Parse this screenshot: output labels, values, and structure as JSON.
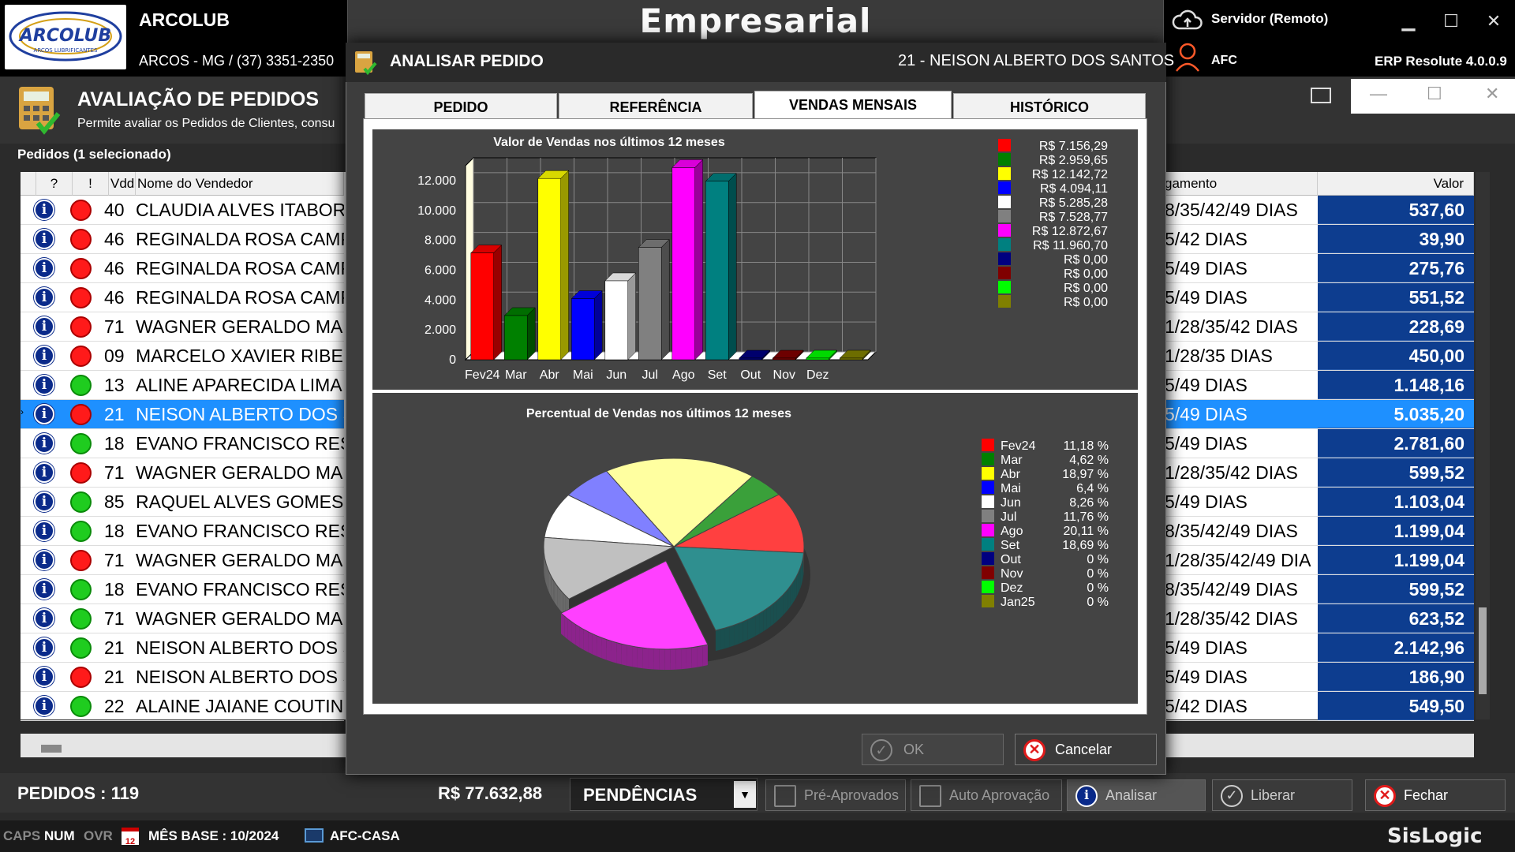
{
  "header": {
    "logo_text": "ARCOLUB",
    "logo_sub": "ARCOS LUBRIFICANTES",
    "company": "ARCOLUB",
    "address": "ARCOS - MG / (37) 3351-2350",
    "app_title": "Empresarial",
    "server": "Servidor (Remoto)",
    "user": "AFC",
    "erp": "ERP Resolute 4.0.0.9"
  },
  "screen": {
    "title": "AVALIAÇÃO DE PEDIDOS",
    "description": "Permite avaliar os Pedidos de Clientes, consu",
    "selection_label": "Pedidos (1 selecionado)"
  },
  "grid": {
    "headers": {
      "q": "?",
      "excl": "!",
      "vdd": "Vdd",
      "name": "Nome do Vendedor",
      "pay": "gamento",
      "value": "Valor"
    },
    "rows": [
      {
        "status": "red",
        "vdd": "40",
        "name": "CLAUDIA ALVES ITABORA",
        "pay": "8/35/42/49 DIAS",
        "value": "537,60",
        "selected": false
      },
      {
        "status": "red",
        "vdd": "46",
        "name": "REGINALDA ROSA CAMP",
        "pay": "5/42 DIAS",
        "value": "39,90",
        "selected": false
      },
      {
        "status": "red",
        "vdd": "46",
        "name": "REGINALDA ROSA CAMP",
        "pay": "5/49 DIAS",
        "value": "275,76",
        "selected": false
      },
      {
        "status": "red",
        "vdd": "46",
        "name": "REGINALDA ROSA CAMP",
        "pay": "5/49 DIAS",
        "value": "551,52",
        "selected": false
      },
      {
        "status": "red",
        "vdd": "71",
        "name": "WAGNER GERALDO MAR",
        "pay": "1/28/35/42 DIAS",
        "value": "228,69",
        "selected": false
      },
      {
        "status": "red",
        "vdd": "09",
        "name": "MARCELO XAVIER RIBEIR",
        "pay": "1/28/35 DIAS",
        "value": "450,00",
        "selected": false
      },
      {
        "status": "green",
        "vdd": "13",
        "name": "ALINE APARECIDA LIMA",
        "pay": "5/49 DIAS",
        "value": "1.148,16",
        "selected": false
      },
      {
        "status": "red",
        "vdd": "21",
        "name": "NEISON ALBERTO DOS S",
        "pay": "5/49 DIAS",
        "value": "5.035,20",
        "selected": true
      },
      {
        "status": "green",
        "vdd": "18",
        "name": "EVANO FRANCISCO RESE",
        "pay": "5/49 DIAS",
        "value": "2.781,60",
        "selected": false
      },
      {
        "status": "red",
        "vdd": "71",
        "name": "WAGNER GERALDO MAR",
        "pay": "1/28/35/42 DIAS",
        "value": "599,52",
        "selected": false
      },
      {
        "status": "green",
        "vdd": "85",
        "name": "RAQUEL ALVES GOMES",
        "pay": "5/49 DIAS",
        "value": "1.103,04",
        "selected": false
      },
      {
        "status": "green",
        "vdd": "18",
        "name": "EVANO FRANCISCO RESE",
        "pay": "8/35/42/49 DIAS",
        "value": "1.199,04",
        "selected": false
      },
      {
        "status": "red",
        "vdd": "71",
        "name": "WAGNER GERALDO MAR",
        "pay": "1/28/35/42/49 DIA",
        "value": "1.199,04",
        "selected": false
      },
      {
        "status": "green",
        "vdd": "18",
        "name": "EVANO FRANCISCO RESE",
        "pay": "8/35/42/49 DIAS",
        "value": "599,52",
        "selected": false
      },
      {
        "status": "green",
        "vdd": "71",
        "name": "WAGNER GERALDO MAR",
        "pay": "1/28/35/42 DIAS",
        "value": "623,52",
        "selected": false
      },
      {
        "status": "green",
        "vdd": "21",
        "name": "NEISON ALBERTO DOS S",
        "pay": "5/49 DIAS",
        "value": "2.142,96",
        "selected": false
      },
      {
        "status": "red",
        "vdd": "21",
        "name": "NEISON ALBERTO DOS S",
        "pay": "5/49 DIAS",
        "value": "186,90",
        "selected": false
      },
      {
        "status": "green",
        "vdd": "22",
        "name": "ALAINE JAIANE COUTINH",
        "pay": "5/42 DIAS",
        "value": "549,50",
        "selected": false
      }
    ]
  },
  "bottom": {
    "pedidos": "PEDIDOS : 119",
    "total": "R$ 77.632,88",
    "filter": "PENDÊNCIAS",
    "btn_pre": "Pré-Aprovados",
    "btn_auto": "Auto Aprovação",
    "btn_analisar": "Analisar",
    "btn_liberar": "Liberar",
    "btn_fechar": "Fechar"
  },
  "status": {
    "caps": "CAPS",
    "num": "NUM",
    "ovr": "OVR",
    "calendar_day": "12",
    "mes_base": "MÊS BASE : 10/2024",
    "host": "AFC-CASA",
    "brand": "SisLogic"
  },
  "modal": {
    "title": "ANALISAR PEDIDO",
    "client": "21 - NEISON ALBERTO DOS SANTOS",
    "tabs": [
      "PEDIDO",
      "REFERÊNCIA",
      "VENDAS MENSAIS",
      "HISTÓRICO"
    ],
    "active_tab": 2,
    "ok": "OK",
    "cancel": "Cancelar"
  },
  "chart_data": [
    {
      "type": "bar",
      "title": "Valor de Vendas nos últimos 12 meses",
      "categories": [
        "Fev24",
        "Mar",
        "Abr",
        "Mai",
        "Jun",
        "Jul",
        "Ago",
        "Set",
        "Out",
        "Nov",
        "Dez",
        ""
      ],
      "values": [
        7156.29,
        2959.65,
        12142.72,
        4094.11,
        5285.28,
        7528.77,
        12872.67,
        11960.7,
        0,
        0,
        0,
        0
      ],
      "colors": [
        "#ff0000",
        "#008000",
        "#ffff00",
        "#0000ff",
        "#ffffff",
        "#808080",
        "#ff00ff",
        "#008080",
        "#000080",
        "#800000",
        "#00ff00",
        "#808000"
      ],
      "legend": [
        "R$ 7.156,29",
        "R$ 2.959,65",
        "R$ 12.142,72",
        "R$ 4.094,11",
        "R$ 5.285,28",
        "R$ 7.528,77",
        "R$ 12.872,67",
        "R$ 11.960,70",
        "R$ 0,00",
        "R$ 0,00",
        "R$ 0,00",
        "R$ 0,00"
      ],
      "yticks": [
        "0",
        "2.000",
        "4.000",
        "6.000",
        "8.000",
        "10.000",
        "12.000"
      ],
      "ylim": [
        0,
        13000
      ],
      "grid": true,
      "legend_position": "right"
    },
    {
      "type": "pie",
      "title": "Percentual de Vendas nos últimos 12 meses",
      "labels": [
        "Fev24",
        "Mar",
        "Abr",
        "Mai",
        "Jun",
        "Jul",
        "Ago",
        "Set",
        "Out",
        "Nov",
        "Dez",
        "Jan25"
      ],
      "values": [
        11.18,
        4.62,
        18.97,
        6.4,
        8.26,
        11.76,
        20.11,
        18.69,
        0,
        0,
        0,
        0
      ],
      "display": [
        "11,18 %",
        "4,62 %",
        "18,97 %",
        "6,4 %",
        "8,26 %",
        "11,76 %",
        "20,11 %",
        "18,69 %",
        "0 %",
        "0 %",
        "0 %",
        "0 %"
      ],
      "colors": [
        "#ff0000",
        "#008000",
        "#ffff00",
        "#0000ff",
        "#ffffff",
        "#808080",
        "#ff00ff",
        "#008080",
        "#000080",
        "#800000",
        "#00ff00",
        "#808000"
      ],
      "legend_position": "right"
    }
  ]
}
